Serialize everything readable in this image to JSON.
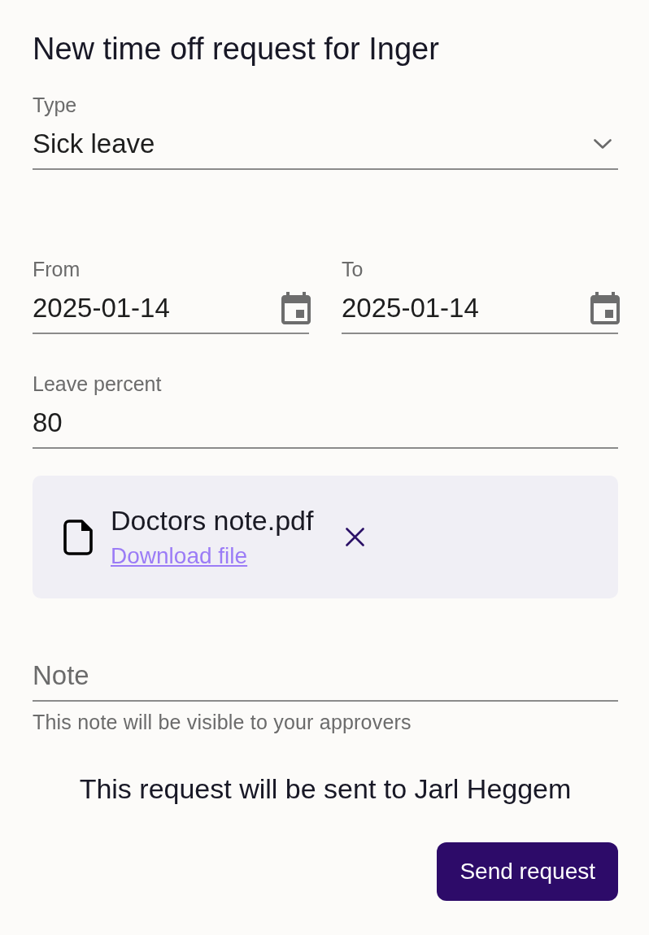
{
  "title": "New time off request for Inger",
  "type_field": {
    "label": "Type",
    "value": "Sick leave"
  },
  "date_fields": [
    {
      "label": "From",
      "value": "2025-01-14"
    },
    {
      "label": "To",
      "value": "2025-01-14"
    }
  ],
  "leave_percent_field": {
    "label": "Leave percent",
    "value": "80"
  },
  "attachment": {
    "file_name": "Doctors note.pdf",
    "link": "Download file"
  },
  "note_field": {
    "placeholder": "Note",
    "helper_text": "This note will be visible to your approvers"
  },
  "recipient_message": "This request will be sent to Jarl Heggem",
  "submit_button": {
    "label": "Send request"
  }
}
